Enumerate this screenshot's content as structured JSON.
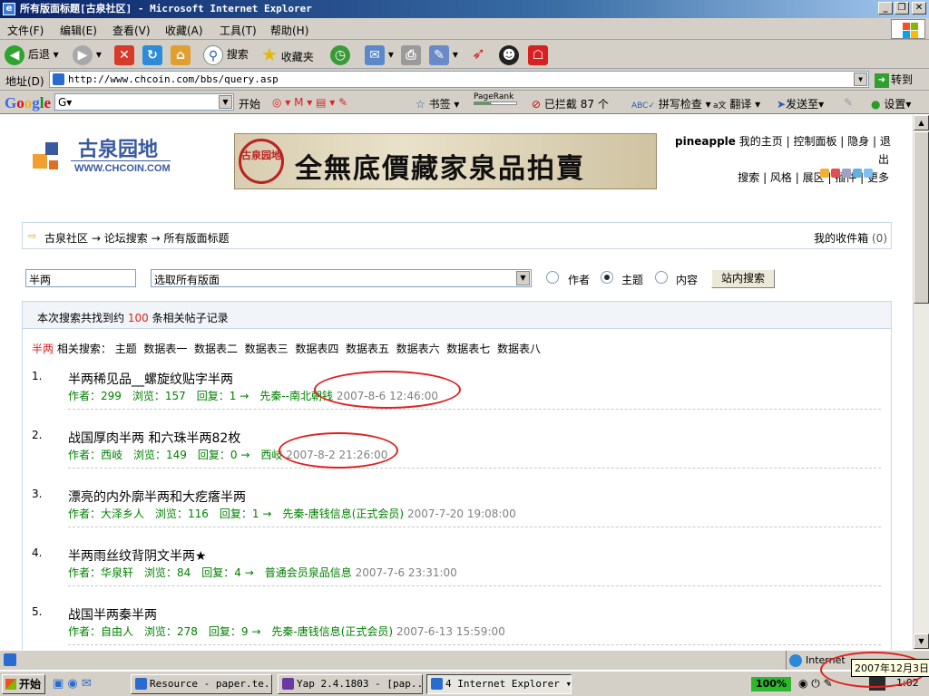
{
  "window": {
    "title": "所有版面标题[古泉社区] - Microsoft Internet Explorer"
  },
  "menu": [
    "文件(F)",
    "编辑(E)",
    "查看(V)",
    "收藏(A)",
    "工具(T)",
    "帮助(H)"
  ],
  "toolbar": {
    "back": "后退",
    "search": "搜索",
    "favorites": "收藏夹"
  },
  "address": {
    "label": "地址(D)",
    "url": "http://www.chcoin.com/bbs/query.asp",
    "go": "转到"
  },
  "google_bar": {
    "logo": "Google",
    "search_value": "G▾",
    "start": "开始",
    "bookmarks": "书签",
    "pagerank": "PageRank",
    "blocked": "已拦截",
    "blocked_count": "87 个",
    "spellcheck": "拼写检查",
    "translate": "翻译",
    "send": "发送至▾",
    "settings": "设置▾"
  },
  "site": {
    "logo_cn": "古泉园地",
    "logo_en": "WWW.CHCOIN.COM",
    "banner_seal": "古泉园地",
    "banner_text": "全無底價藏家泉品拍賣",
    "user": "pineapple",
    "user_links_1": [
      "我的主页",
      "控制面板",
      "隐身",
      "退"
    ],
    "user_links_1b": "出",
    "user_links_2": [
      "搜索",
      "风格",
      "展区",
      "插件",
      "更多"
    ]
  },
  "breadcrumb": {
    "home": "古泉社区",
    "arrow": "→",
    "l1": "论坛搜索",
    "l2": "所有版面标题",
    "inbox": "我的收件箱",
    "inbox_count": "(0)"
  },
  "search": {
    "keyword": "半两",
    "scope": "选取所有版面",
    "opt_author": "作者",
    "opt_subject": "主题",
    "opt_content": "内容",
    "button": "站内搜索"
  },
  "results": {
    "summary_pre": "本次搜索共找到约",
    "count": "100",
    "summary_post": "条相关帖子记录",
    "keyword": "半两",
    "related_label": "相关搜索：",
    "related": [
      "主题",
      "数据表一",
      "数据表二",
      "数据表三",
      "数据表四",
      "数据表五",
      "数据表六",
      "数据表七",
      "数据表八"
    ],
    "items": [
      {
        "no": "1.",
        "title": "半两稀见品__螺旋纹贴字半两",
        "meta": "作者：299　浏览：157　回复：1 →　先秦--南北朝钱",
        "date": "2007-8-6 12:46:00"
      },
      {
        "no": "2.",
        "title": "战国厚肉半两 和六珠半两82枚",
        "meta": "作者：西岐　浏览：149　回复：0 →　西岐",
        "date": "2007-8-2 21:26:00"
      },
      {
        "no": "3.",
        "title": "漂亮的内外廓半两和大疙瘩半两",
        "meta": "作者：大泽乡人　浏览：116　回复：1 →　先秦-唐钱信息(正式会员)",
        "date": "2007-7-20 19:08:00"
      },
      {
        "no": "4.",
        "title": "半两雨丝纹背阴文半两★",
        "meta": "作者：华泉轩　浏览：84　回复：4 →　普通会员泉品信息",
        "date": "2007-7-6 23:31:00"
      },
      {
        "no": "5.",
        "title": "战国半两秦半两",
        "meta": "作者：自由人　浏览：278　回复：9 →　先秦-唐钱信息(正式会员)",
        "date": "2007-6-13 15:59:00"
      }
    ]
  },
  "status": {
    "zone": "Internet",
    "date_tip": "2007年12月3日"
  },
  "taskbar": {
    "start": "开始",
    "tasks": [
      "Resource - paper.te...",
      "Yap 2.4.1803 - [pap...",
      "4 Internet Explorer"
    ],
    "zoom": "100%",
    "time": "1:02"
  },
  "colors": {
    "title_bar": "#0a246a",
    "keyword_red": "#e02020",
    "meta_green": "#008000",
    "annotation_red": "#e02020"
  }
}
